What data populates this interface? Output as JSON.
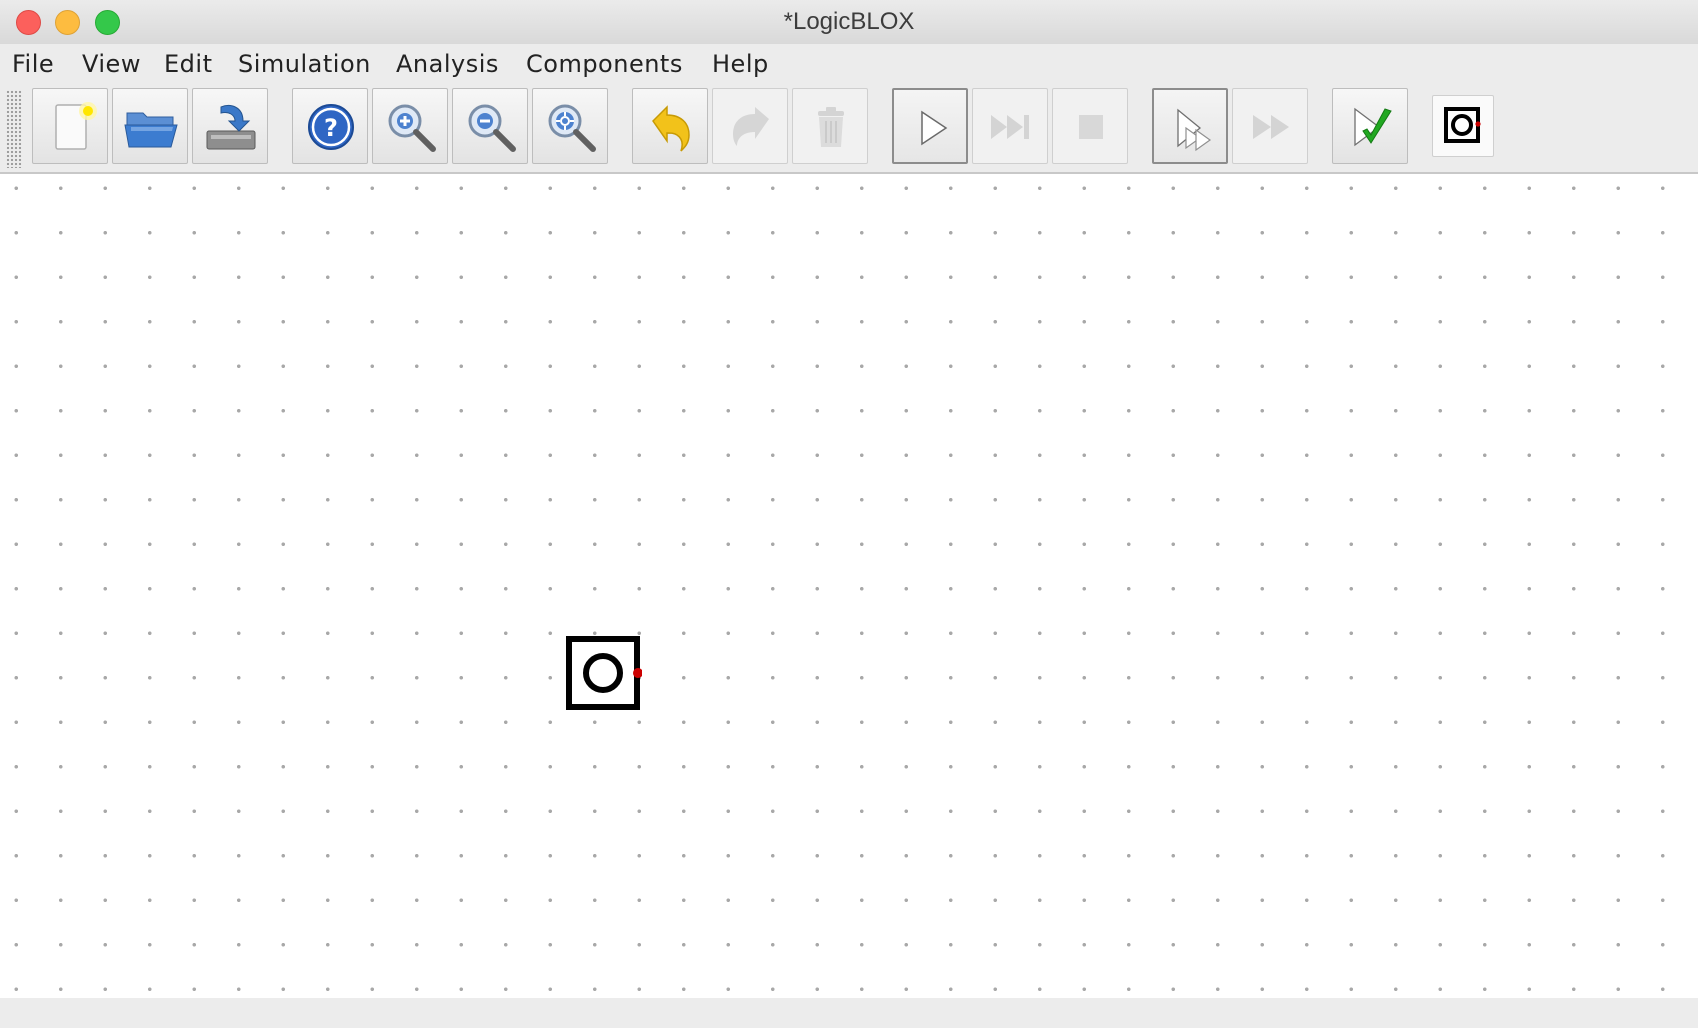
{
  "window": {
    "title": "*LogicBLOX"
  },
  "menubar": {
    "items": [
      {
        "label": "File"
      },
      {
        "label": "View"
      },
      {
        "label": "Edit"
      },
      {
        "label": "Simulation"
      },
      {
        "label": "Analysis"
      },
      {
        "label": "Components"
      },
      {
        "label": "Help"
      }
    ]
  },
  "toolbar": {
    "buttons": [
      {
        "icon": "new-file-icon",
        "enabled": true
      },
      {
        "icon": "open-folder-icon",
        "enabled": true
      },
      {
        "icon": "save-disk-icon",
        "enabled": true
      },
      {
        "icon": "help-icon",
        "enabled": true
      },
      {
        "icon": "zoom-in-icon",
        "enabled": true
      },
      {
        "icon": "zoom-out-icon",
        "enabled": true
      },
      {
        "icon": "zoom-fit-icon",
        "enabled": true
      },
      {
        "icon": "undo-icon",
        "enabled": true
      },
      {
        "icon": "redo-icon",
        "enabled": false
      },
      {
        "icon": "trash-icon",
        "enabled": false
      },
      {
        "icon": "play-icon",
        "enabled": true,
        "pressed": true
      },
      {
        "icon": "step-icon",
        "enabled": false
      },
      {
        "icon": "stop-icon",
        "enabled": false
      },
      {
        "icon": "multi-select-icon",
        "enabled": true,
        "pressed": true
      },
      {
        "icon": "fast-forward-icon",
        "enabled": false
      },
      {
        "icon": "check-icon",
        "enabled": true
      },
      {
        "icon": "output-component-icon",
        "enabled": true
      }
    ]
  },
  "canvas": {
    "components": [
      {
        "type": "output-pin",
        "icon": "output-pin-icon",
        "connector_color": "#cc0000"
      }
    ]
  },
  "colors": {
    "window_bg": "#ececec",
    "canvas_bg": "#ffffff",
    "grid_dot": "#a8a8a8",
    "help_blue": "#2f66c4",
    "undo_yellow": "#f2c21a",
    "check_green": "#22a822",
    "connector_red": "#cc0000"
  }
}
